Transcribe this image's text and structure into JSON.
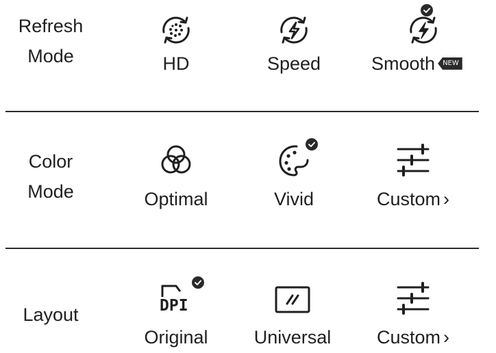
{
  "colors": {
    "text": "#1f1f1f",
    "divider": "#2a2a2a",
    "badge_bg": "#2a2a2a"
  },
  "refresh": {
    "label_line1": "Refresh",
    "label_line2": "Mode",
    "options": [
      {
        "label": "HD",
        "icon": "hd-refresh-icon",
        "selected": false
      },
      {
        "label": "Speed",
        "icon": "speed-refresh-icon",
        "selected": false
      },
      {
        "label": "Smooth",
        "icon": "smooth-refresh-icon",
        "selected": true,
        "badge": "NEW"
      }
    ]
  },
  "color": {
    "label_line1": "Color",
    "label_line2": "Mode",
    "options": [
      {
        "label": "Optimal",
        "icon": "optimal-color-icon",
        "selected": false
      },
      {
        "label": "Vivid",
        "icon": "palette-icon",
        "selected": true
      },
      {
        "label": "Custom",
        "arrow": "›",
        "icon": "sliders-icon",
        "selected": false
      }
    ]
  },
  "layout": {
    "label": "Layout",
    "options": [
      {
        "label": "Original",
        "icon": "dpi-icon",
        "icon_text": "DPI",
        "selected": true
      },
      {
        "label": "Universal",
        "icon": "universal-layout-icon",
        "selected": false
      },
      {
        "label": "Custom",
        "arrow": "›",
        "icon": "sliders-icon",
        "selected": false
      }
    ]
  }
}
